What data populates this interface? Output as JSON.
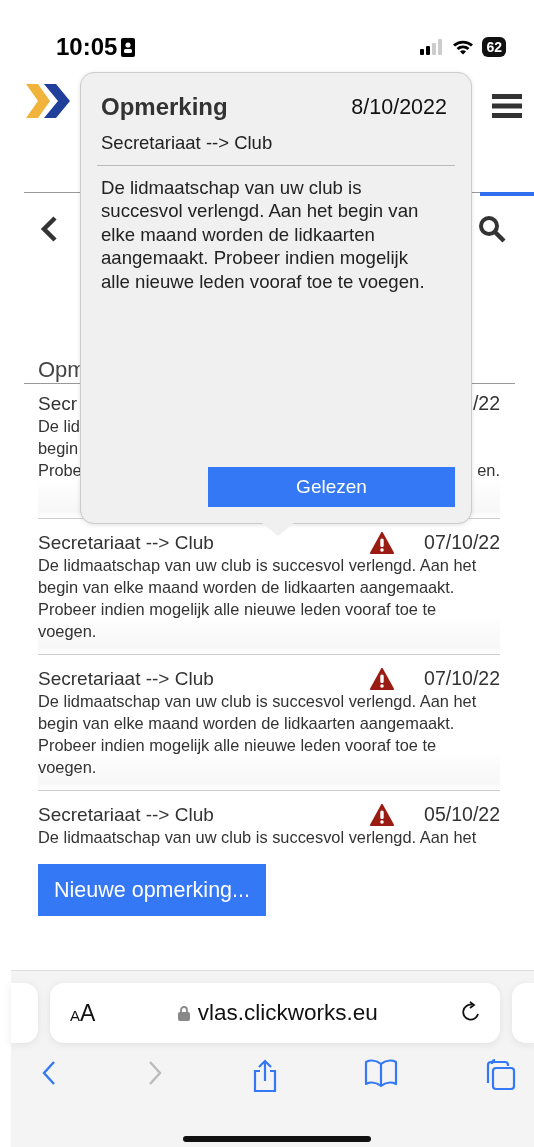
{
  "status_bar": {
    "time": "10:05",
    "battery": "62"
  },
  "page": {
    "heading": "Opm"
  },
  "messages": [
    {
      "kind": "covered",
      "title": "Secr",
      "date": "/22",
      "lines": [
        "De lid",
        "begin",
        "Probe"
      ],
      "line_end": "en."
    },
    {
      "kind": "full",
      "title": "Secretariaat --> Club",
      "warning": true,
      "date": "07/10/22",
      "message": "De lidmaatschap van uw club is succesvol verlengd. Aan het begin van elke maand worden de lidkaarten aangemaakt. Probeer indien mogelijk alle nieuwe leden vooraf toe te voegen."
    },
    {
      "kind": "full",
      "title": "Secretariaat --> Club",
      "warning": true,
      "date": "07/10/22",
      "message": "De lidmaatschap van uw club is succesvol verlengd. Aan het begin van elke maand worden de lidkaarten aangemaakt. Probeer indien mogelijk alle nieuwe leden vooraf toe te voegen."
    },
    {
      "kind": "cut",
      "title": "Secretariaat --> Club",
      "warning": true,
      "date": "05/10/22",
      "message": "De lidmaatschap van uw club is succesvol verlengd. Aan het"
    }
  ],
  "new_button": "Nieuwe opmerking...",
  "popover": {
    "title": "Opmerking",
    "date": "8/10/2022",
    "route": "Secretariaat --> Club",
    "message": "De lidmaatschap van uw club is succesvol verlengd. Aan het begin van elke maand worden de lidkaarten aangemaakt. Probeer indien mogelijk alle nieuwe leden vooraf toe te voegen.",
    "button": "Gelezen"
  },
  "browser": {
    "text_size": "AA",
    "url": "vlas.clickworks.eu",
    "back_enabled": true,
    "forward_enabled": false
  }
}
